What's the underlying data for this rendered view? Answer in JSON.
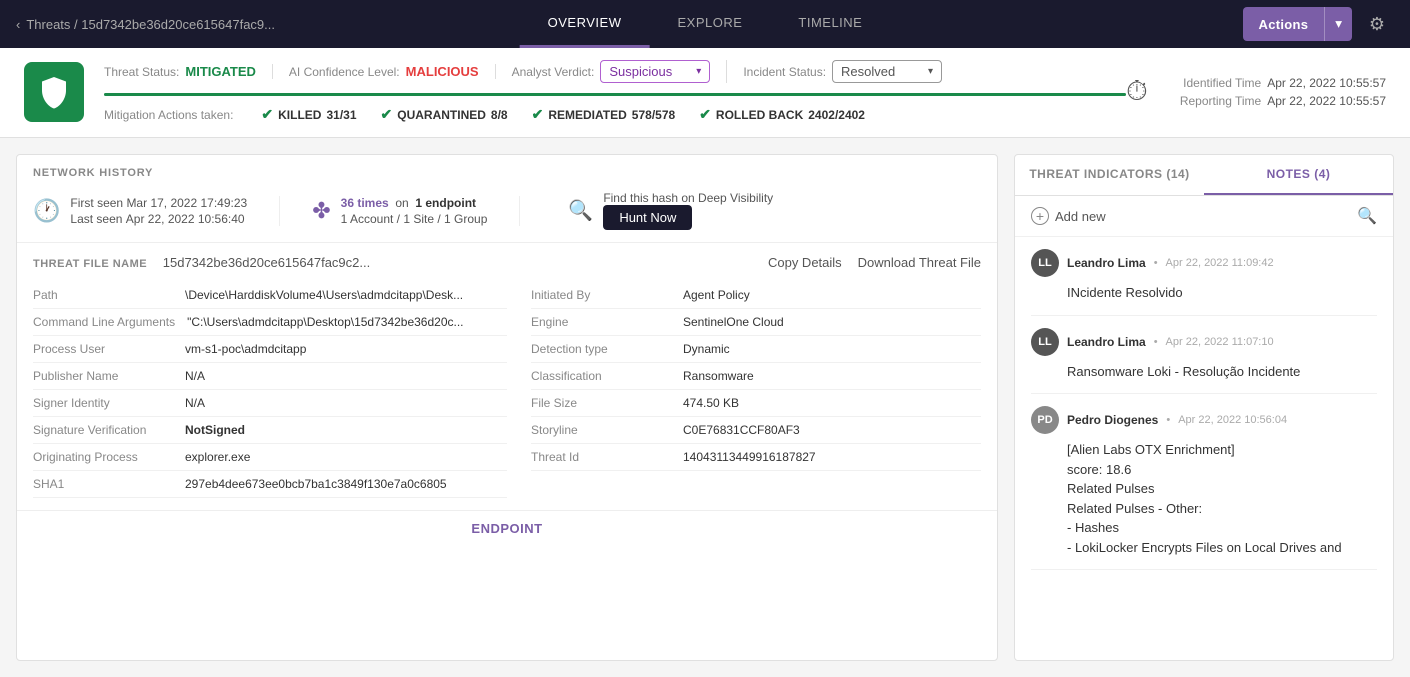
{
  "nav": {
    "breadcrumb_icon": "‹",
    "breadcrumb_path": "Threats / 15d7342be36d20ce615647fac9...",
    "tabs": [
      {
        "label": "OVERVIEW",
        "active": true
      },
      {
        "label": "EXPLORE",
        "active": false
      },
      {
        "label": "TIMELINE",
        "active": false
      }
    ],
    "actions_label": "Actions",
    "gear_icon": "⚙"
  },
  "status_bar": {
    "threat_status_label": "Threat Status:",
    "threat_status_value": "MITIGATED",
    "ai_confidence_label": "AI Confidence Level:",
    "ai_confidence_value": "MALICIOUS",
    "analyst_verdict_label": "Analyst Verdict:",
    "analyst_verdict_value": "Suspicious",
    "incident_status_label": "Incident Status:",
    "incident_status_value": "Resolved",
    "identified_time_label": "Identified Time",
    "identified_time_value": "Apr 22, 2022 10:55:57",
    "reporting_time_label": "Reporting Time",
    "reporting_time_value": "Apr 22, 2022 10:55:57",
    "mitigation_label": "Mitigation Actions taken:",
    "killed_label": "KILLED",
    "killed_count": "31/31",
    "quarantined_label": "QUARANTINED",
    "quarantined_count": "8/8",
    "remediated_label": "REMEDIATED",
    "remediated_count": "578/578",
    "rolled_back_label": "ROLLED BACK",
    "rolled_back_count": "2402/2402"
  },
  "network_history": {
    "section_title": "NETWORK HISTORY",
    "first_seen_label": "First seen",
    "first_seen_value": "Mar 17, 2022 17:49:23",
    "last_seen_label": "Last seen",
    "last_seen_value": "Apr 22, 2022 10:56:40",
    "times_count": "36 times",
    "times_suffix": "on",
    "endpoint_count": "1 endpoint",
    "account_info": "1 Account / 1 Site / 1 Group",
    "hunt_label": "Find this hash on Deep Visibility",
    "hunt_btn": "Hunt Now"
  },
  "threat_file": {
    "name_label": "THREAT FILE NAME",
    "name_value": "15d7342be36d20ce615647fac9c2...",
    "copy_btn": "Copy Details",
    "download_btn": "Download Threat File",
    "fields_left": [
      {
        "key": "Path",
        "value": "\\Device\\HarddiskVolume4\\Users\\admdcitapp\\Desk..."
      },
      {
        "key": "Command Line Arguments",
        "value": "\"C:\\Users\\admdcitapp\\Desktop\\15d7342be36d20c..."
      },
      {
        "key": "Process User",
        "value": "vm-s1-poc\\admdcitapp"
      },
      {
        "key": "Publisher Name",
        "value": "N/A"
      },
      {
        "key": "Signer Identity",
        "value": "N/A"
      },
      {
        "key": "Signature Verification",
        "value": "NotSigned"
      },
      {
        "key": "Originating Process",
        "value": "explorer.exe"
      },
      {
        "key": "SHA1",
        "value": "297eb4dee673ee0bcb7ba1c3849f130e7a0c6805"
      }
    ],
    "fields_right": [
      {
        "key": "Initiated By",
        "value": "Agent Policy"
      },
      {
        "key": "Engine",
        "value": "SentinelOne Cloud"
      },
      {
        "key": "Detection type",
        "value": "Dynamic"
      },
      {
        "key": "Classification",
        "value": "Ransomware"
      },
      {
        "key": "File Size",
        "value": "474.50 KB"
      },
      {
        "key": "Storyline",
        "value": "C0E76831CCF80AF3"
      },
      {
        "key": "Threat Id",
        "value": "14043113449916187827"
      }
    ]
  },
  "endpoint_section": {
    "title": "ENDPOINT"
  },
  "right_panel": {
    "tabs": [
      {
        "label": "THREAT INDICATORS (14)",
        "active": false
      },
      {
        "label": "NOTES (4)",
        "active": true
      }
    ],
    "add_new_label": "Add new",
    "notes": [
      {
        "author": "Leandro Lima",
        "date": "Apr 22, 2022 11:09:42",
        "initials": "LL",
        "body": "INcidente Resolvido"
      },
      {
        "author": "Leandro Lima",
        "date": "Apr 22, 2022 11:07:10",
        "initials": "LL",
        "body": "Ransomware Loki - Resolução Incidente"
      },
      {
        "author": "Pedro Diogenes",
        "date": "Apr 22, 2022 10:56:04",
        "initials": "PD",
        "body_lines": [
          "[Alien Labs OTX Enrichment]",
          "score: 18.6",
          "Related Pulses",
          "Related Pulses - Other:",
          "  - Hashes",
          "  - LokiLocker Encrypts Files on Local Drives and"
        ]
      }
    ]
  }
}
